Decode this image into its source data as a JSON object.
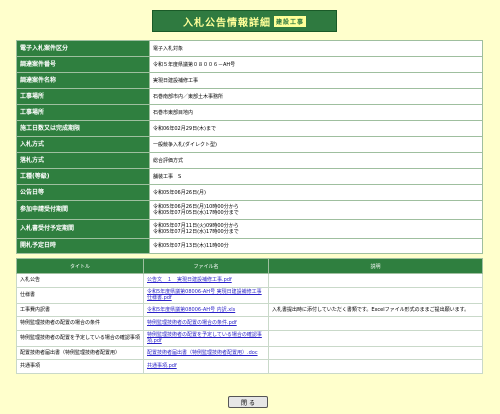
{
  "header": {
    "title": "入札公告情報詳細",
    "subtitle": "建設工事"
  },
  "details": [
    {
      "label": "電子入札案件区分",
      "value": "電子入札対象"
    },
    {
      "label": "調達案件番号",
      "value": "令和５年度県議第０８００６－AH号"
    },
    {
      "label": "調達案件名称",
      "value": "実現日建設補修工事"
    },
    {
      "label": "工事場所",
      "value": "石巻南部市内／東部土木事務所"
    },
    {
      "label": "工事場所",
      "value": "石巻市東部目地内"
    },
    {
      "label": "施工日数又は完成期限",
      "value": "令和06年02月29日(木)まで"
    },
    {
      "label": "入札方式",
      "value": "一般競争入札(ダイレクト型)"
    },
    {
      "label": "落札方式",
      "value": "総合評価方式"
    },
    {
      "label": "工種(等級)",
      "value": "舗装工事　S"
    },
    {
      "label": "公告日等",
      "value": "令和05年06月26日(月)"
    },
    {
      "label": "参加申請受付期間",
      "value": [
        "令和05年06月26日(月)10時00分から",
        "令和05年07月05日(水)17時00分まで"
      ]
    },
    {
      "label": "入札書受付予定期間",
      "value": [
        "令和05年07月11日(火)09時00分から",
        "令和05年07月12日(水)17時00分まで"
      ]
    },
    {
      "label": "開札予定日時",
      "value": "令和05年07月13日(木)11時00分"
    }
  ],
  "files": {
    "headers": [
      "タイトル",
      "ファイル名",
      "説明"
    ],
    "rows": [
      {
        "title": "入札公告",
        "file": "公告文　１　実現日建設補修工事.pdf",
        "note": ""
      },
      {
        "title": "仕様書",
        "file": "令和5年度県議第08006-AH号 実現日建設補修工事 仕様書.pdf",
        "note": ""
      },
      {
        "title": "工事費内訳書",
        "file": "令和5年度県議第08006-AH号 内訳.xls",
        "note": "入札書提出時に添付していただく書類です。Excelファイル形式のままご提出願います。"
      },
      {
        "title": "特例監理技術者の配置の場合の条件",
        "file": "特例監理技術者の配置の場合の条件.pdf",
        "note": ""
      },
      {
        "title": "特例監理技術者の配置を予定している場合の確認事項",
        "file": "特例監理技術者の配置を予定している場合の確認事項.pdf",
        "note": ""
      },
      {
        "title": "配置技術者届出書（特例監理技術者配置用）",
        "file": "配置技術者届出書（特例監理技術者配置用）.doc",
        "note": ""
      },
      {
        "title": "共通事項",
        "file": "共通事項.pdf",
        "note": ""
      }
    ]
  },
  "footer": {
    "close_label": "閉 る"
  }
}
